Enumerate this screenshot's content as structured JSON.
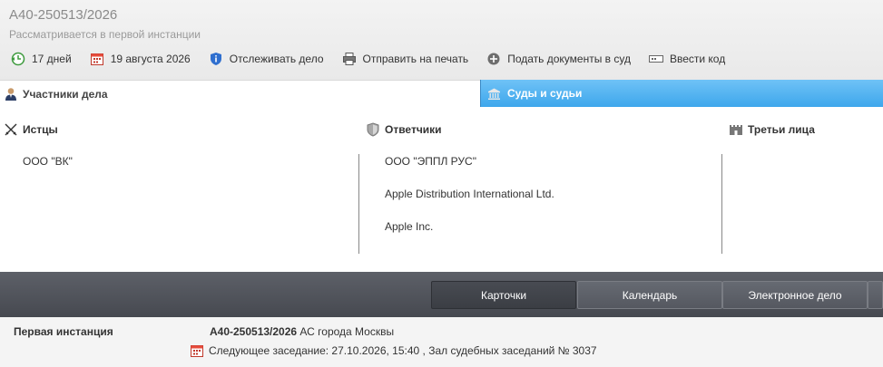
{
  "header": {
    "case_number": "А40-250513/2026",
    "status": "Рассматривается в первой инстанции"
  },
  "toolbar": {
    "days_label": "17 дней",
    "date_label": "19 августа 2026",
    "track_label": "Отслеживать дело",
    "print_label": "Отправить на печать",
    "submit_label": "Подать документы в суд",
    "code_label": "Ввести код"
  },
  "tabs": {
    "participants": "Участники дела",
    "courts": "Суды и судьи"
  },
  "columns": {
    "plaintiffs": {
      "title": "Истцы",
      "items": [
        "ООО \"ВК\""
      ]
    },
    "defendants": {
      "title": "Ответчики",
      "items": [
        "ООО \"ЭППЛ РУС\"",
        "Apple Distribution International Ltd.",
        "Apple Inc."
      ]
    },
    "third": {
      "title": "Третьи лица",
      "items": []
    }
  },
  "bottom_nav": {
    "cards": "Карточки",
    "calendar": "Календарь",
    "electronic": "Электронное дело"
  },
  "footer": {
    "instance_label": "Первая инстанция",
    "case_number": "А40-250513/2026",
    "court": " АС города Москвы",
    "next_session": "Следующее заседание: 27.10.2026, 15:40 , Зал судебных заседаний № 3037"
  },
  "colors": {
    "accent_blue": "#3ea7ec",
    "dark_bar": "#4f5259"
  }
}
